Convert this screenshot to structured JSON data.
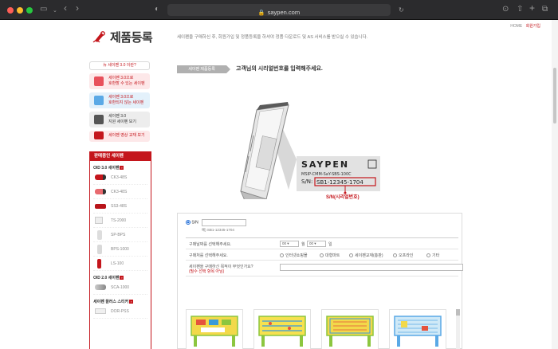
{
  "browser": {
    "url": "saypen.com"
  },
  "header": {
    "util_links": [
      "HOME",
      "회원가입"
    ],
    "title": "제품등록",
    "description": "세이펜을 구매하신 후, 회원가입 및 정품등록을 하셔야 정품 다운로드 및 AS 서비스를 받으실 수 있습니다."
  },
  "sidebar": {
    "new_link": "뉴 세이펜 3.0 이란?",
    "buttons": [
      {
        "line1": "세이펜 3.0으로",
        "line2": "호환할 수 있는 세이펜"
      },
      {
        "line1": "세이펜 3.0으로",
        "line2": "호환되지 않는 세이펜"
      },
      {
        "line1": "세이펜 3.0",
        "line2": "지원 세이펜 보기"
      },
      {
        "line1": "세이펜 영상 교재 보기",
        "line2": ""
      }
    ],
    "product_box_title": "판매중인 세이펜",
    "series": [
      {
        "name": "OID 3.0 세이펜",
        "items": [
          "CK3-48S",
          "CK3-48S",
          "SS3-48S",
          "TS-2000",
          "SP-BPS",
          "BPS-1000",
          "LS-100"
        ]
      },
      {
        "name": "OID 2.0 세이펜",
        "items": [
          "SCA-1000"
        ]
      },
      {
        "name": "세이펜 플러스 스티커",
        "items": [
          "DOR-PSS"
        ]
      }
    ]
  },
  "step": {
    "label": "세이펜 제품등록",
    "instruction": "고객님의 시리얼번호를 입력해주세요."
  },
  "illustration": {
    "brand": "SAYPEN",
    "model_line": "MSIP-CMM-SaY-SBS-100C",
    "sn_prefix": "S/N:",
    "sn_value": "SB1-12345-1704",
    "caption": "S/N(시리얼번호)"
  },
  "form": {
    "sn_label": "S/N",
    "sn_example": "예) SB1-12345-1704",
    "purchase_date_label": "구매날짜를 선택해주세요.",
    "purchase_month": "00",
    "purchase_unit_month": "월",
    "purchase_day": "00",
    "purchase_unit_day": "일",
    "channel_label": "구매처를 선택해주세요.",
    "channel_options": [
      "인터넷쇼핑몰",
      "대형마트",
      "세이펜교재(총판)",
      "오프라인",
      "기타"
    ],
    "reason_label": "세이펜을 구매하신 목적이 무엇인가요?",
    "reason_note": "(필수 선택 항목 아님)",
    "product_images": [
      "보드게임 테이블",
      "보드게임 테이블",
      "보드게임 테이블",
      "보드게임 테이블"
    ]
  },
  "colors": {
    "brand_red": "#c4161c",
    "accent_blue": "#2a73d9"
  }
}
